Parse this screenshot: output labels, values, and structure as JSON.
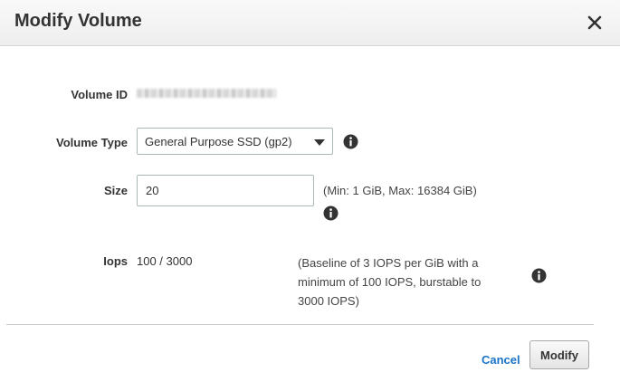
{
  "dialog": {
    "title": "Modify Volume",
    "close_icon": "close-icon"
  },
  "form": {
    "volume_id": {
      "label": "Volume ID"
    },
    "volume_type": {
      "label": "Volume Type",
      "selected": "General Purpose SSD (gp2)",
      "info_icon": "info-icon"
    },
    "size": {
      "label": "Size",
      "value": "20",
      "hint": "(Min: 1 GiB, Max: 16384 GiB)",
      "info_icon": "info-icon"
    },
    "iops": {
      "label": "Iops",
      "value": "100 / 3000",
      "desc_line1": "(Baseline of 3 IOPS per GiB with a",
      "desc_line2": "minimum of 100 IOPS, burstable to",
      "desc_line3": "3000 IOPS)",
      "info_icon": "info-icon"
    }
  },
  "footer": {
    "cancel_label": "Cancel",
    "modify_label": "Modify"
  },
  "colors": {
    "link": "#1a73c8",
    "text": "#333333",
    "header_bg": "#eeeeee",
    "border": "#aab7b8"
  }
}
